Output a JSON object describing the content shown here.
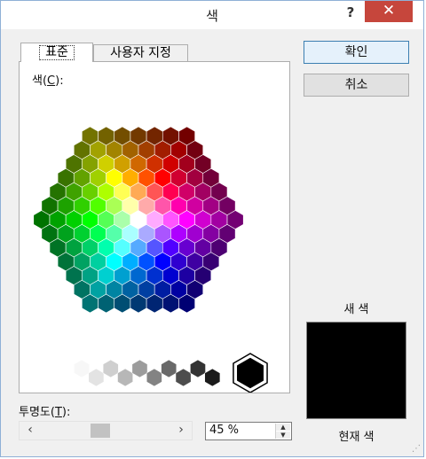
{
  "window": {
    "title": "색",
    "help_glyph": "?",
    "close_glyph": "✕"
  },
  "tabs": [
    {
      "label": "표준",
      "selected": true
    },
    {
      "label": "사용자 지정",
      "selected": false
    }
  ],
  "colors": {
    "label_prefix": "색(",
    "label_key": "C",
    "label_suffix": "):"
  },
  "buttons": {
    "ok": "확인",
    "cancel": "취소"
  },
  "preview": {
    "new_label": "새 색",
    "current_label": "현재 색",
    "color": "#000000"
  },
  "opacity": {
    "label_prefix": "투명도(",
    "label_key": "T",
    "label_suffix": "):",
    "value": "45 %",
    "level_percent": 45
  },
  "icons": {
    "scroll_left": "‹",
    "scroll_right": "›",
    "spin_up": "▲",
    "spin_down": "▼"
  },
  "grayscale_selected_color": "#000000"
}
